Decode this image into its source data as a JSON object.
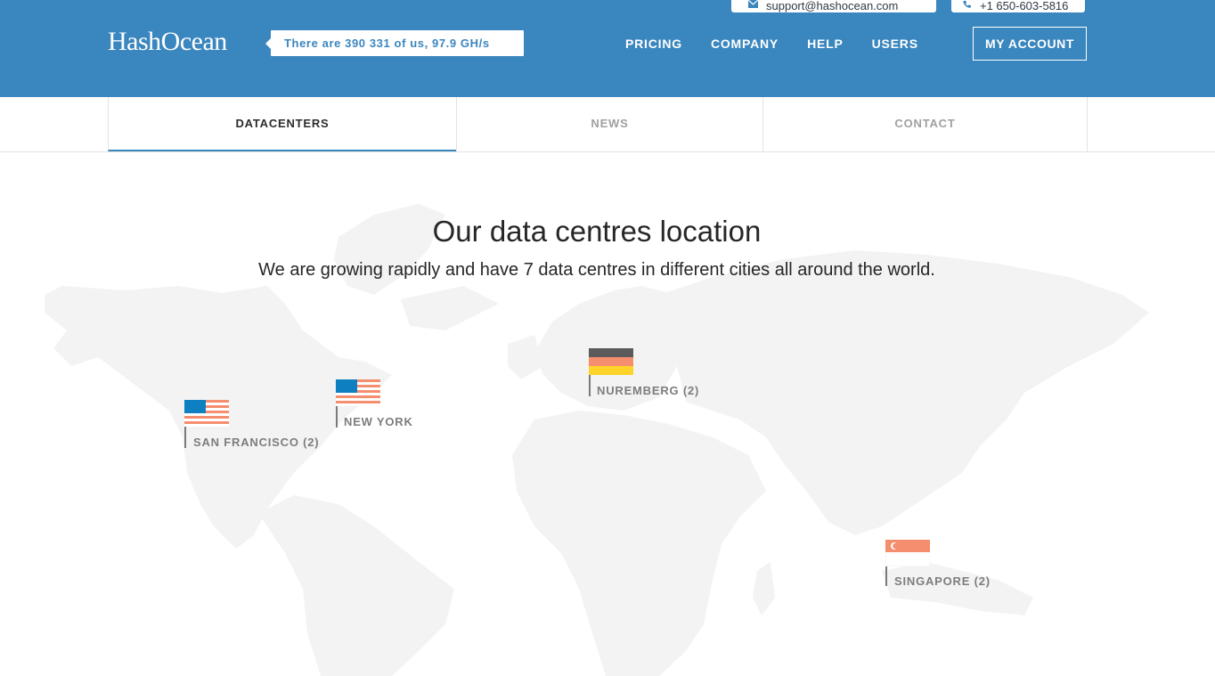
{
  "header": {
    "logo": "HashOcean",
    "stats": "There are 390 331 of us, 97.9 GH/s",
    "email": "support@hashocean.com",
    "phone": "+1 650-603-5816",
    "nav": [
      "PRICING",
      "COMPANY",
      "HELP",
      "USERS"
    ],
    "account": "MY ACCOUNT"
  },
  "tabs": [
    "DATACENTERS",
    "NEWS",
    "CONTACT"
  ],
  "main": {
    "title": "Our data centres location",
    "subtitle": "We are growing rapidly and have 7 data centres in different cities all around the world."
  },
  "locations": [
    {
      "label": "SAN FRANCISCO (2)",
      "flag": "us-flag-icon"
    },
    {
      "label": "NEW YORK",
      "flag": "us-flag-icon"
    },
    {
      "label": "NUREMBERG (2)",
      "flag": "germany-flag-icon"
    },
    {
      "label": "SINGAPORE (2)",
      "flag": "singapore-flag-icon"
    }
  ],
  "colors": {
    "brand": "#3a86be",
    "map": "#f3f3f3",
    "flag_stripe": "#f58e6e",
    "flag_canton": "#0e7fc0"
  }
}
